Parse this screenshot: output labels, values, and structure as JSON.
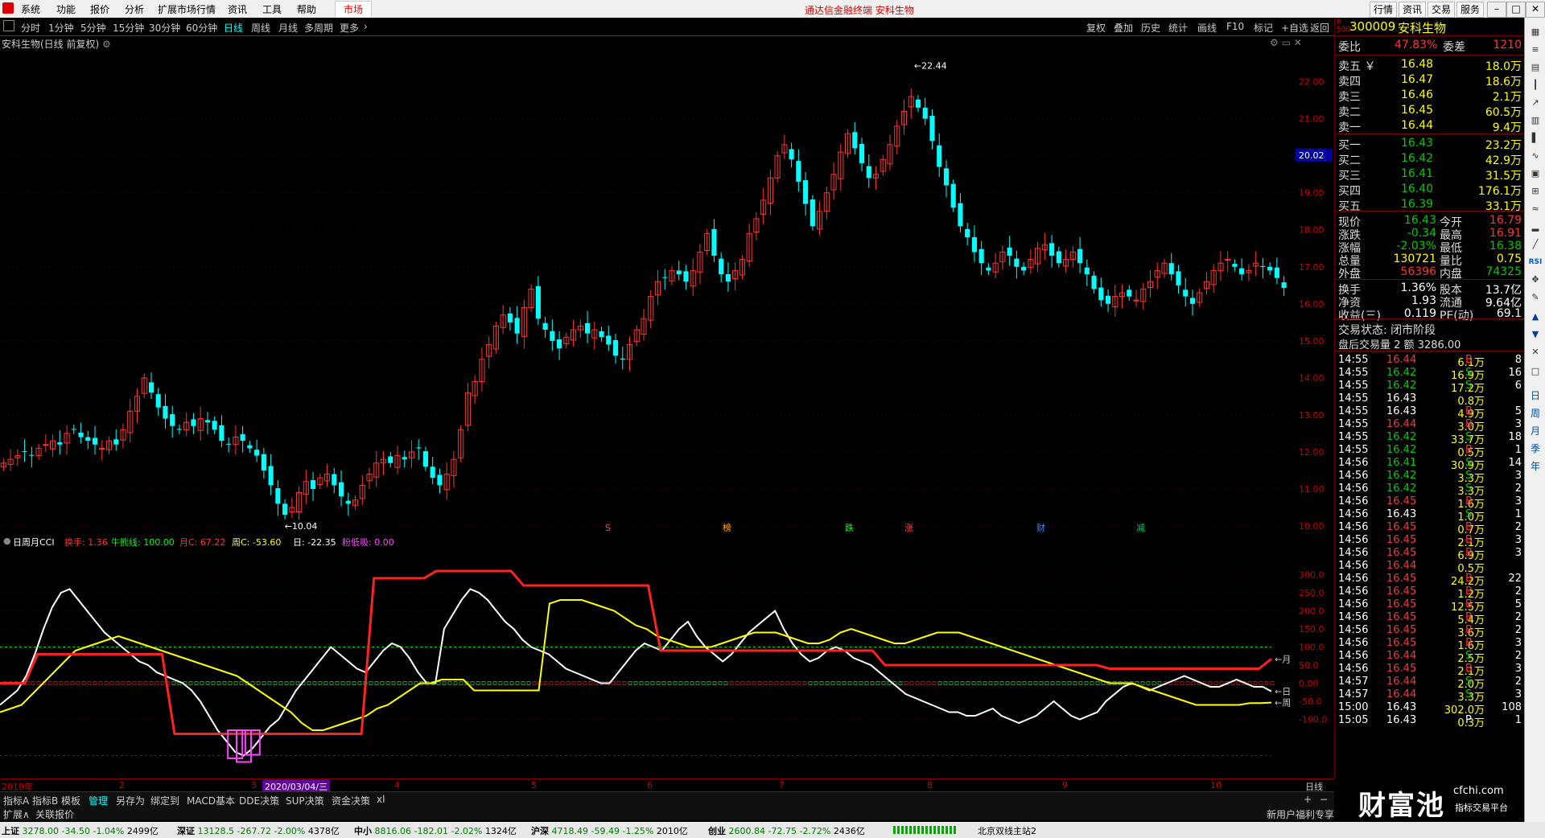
{
  "app": {
    "menu": [
      "系统",
      "功能",
      "报价",
      "分析",
      "扩展市场行情",
      "资讯",
      "工具",
      "帮助"
    ],
    "market_tab": "市场",
    "center_title": "通达信金融终端  安科生物",
    "right_buttons": [
      "行情",
      "资讯",
      "交易",
      "服务"
    ]
  },
  "periods": {
    "items": [
      "分时",
      "1分钟",
      "5分钟",
      "15分钟",
      "30分钟",
      "60分钟",
      "日线",
      "周线",
      "月线",
      "多周期",
      "更多"
    ],
    "active": "日线"
  },
  "chart_tools": [
    "复权",
    "叠加",
    "历史",
    "统计",
    "画线",
    "F10",
    "标记",
    "+自选",
    "返回"
  ],
  "stock_title": "安科生物(日线 前复权)",
  "indicator": {
    "name": "日周月CCI",
    "values": [
      {
        "label": "换手: 1.36",
        "color": "#ff3333"
      },
      {
        "label": "牛熊线: 100.00",
        "color": "#00ff00"
      },
      {
        "label": "月C: 67.22",
        "color": "#ff3333"
      },
      {
        "label": "周C: -53.60",
        "color": "#ffff00"
      },
      {
        "label": "日: -22.35",
        "color": "#ffffff"
      },
      {
        "label": "粉低吸: 0.00",
        "color": "#ff44ff"
      }
    ]
  },
  "chart_data": [
    {
      "type": "candlestick",
      "title": "安科生物(日线 前复权)",
      "ylim": [
        10.0,
        22.6
      ],
      "y_ticks": [
        "22.00",
        "21.00",
        "20.00",
        "19.00",
        "18.00",
        "17.00",
        "16.00",
        "15.00",
        "14.00",
        "13.00",
        "12.00",
        "11.00",
        "10.00"
      ],
      "current_price_label": "20.02",
      "annotations": [
        {
          "text": "22.44",
          "x": "2020/06",
          "y": 22.44
        },
        {
          "text": "10.04",
          "x": "2020/02",
          "y": 10.04
        }
      ],
      "event_markers": [
        "S",
        "榜",
        "跌",
        "涨",
        "财",
        "减"
      ],
      "close": [
        11.7,
        11.8,
        11.9,
        12.0,
        11.9,
        12.1,
        12.2,
        12.3,
        12.2,
        12.5,
        12.6,
        12.4,
        12.3,
        12.2,
        12.1,
        12.3,
        12.2,
        12.6,
        13.1,
        13.5,
        14.0,
        13.6,
        13.2,
        12.9,
        12.7,
        12.6,
        12.8,
        12.7,
        12.9,
        12.8,
        12.6,
        12.3,
        12.2,
        12.4,
        12.3,
        12.1,
        11.9,
        11.5,
        11.1,
        10.6,
        10.3,
        10.5,
        10.9,
        11.2,
        11.0,
        11.3,
        11.4,
        11.1,
        10.8,
        10.6,
        10.7,
        11.1,
        11.4,
        11.7,
        11.8,
        11.7,
        11.9,
        11.8,
        12.0,
        12.1,
        11.6,
        11.3,
        11.1,
        11.4,
        11.8,
        12.6,
        13.6,
        13.9,
        14.5,
        14.9,
        15.4,
        15.7,
        15.5,
        15.2,
        15.9,
        16.4,
        15.6,
        15.3,
        15.0,
        14.8,
        15.1,
        15.3,
        15.4,
        15.2,
        15.3,
        15.1,
        14.9,
        14.6,
        14.5,
        14.9,
        15.3,
        15.6,
        16.2,
        16.6,
        16.7,
        16.9,
        16.8,
        16.6,
        16.9,
        17.4,
        17.9,
        17.3,
        16.8,
        16.6,
        16.9,
        17.2,
        17.9,
        18.3,
        18.8,
        19.4,
        20.0,
        20.3,
        19.9,
        19.3,
        18.7,
        18.1,
        18.5,
        19.0,
        19.5,
        20.1,
        20.6,
        20.2,
        19.8,
        19.4,
        19.5,
        19.9,
        20.3,
        20.8,
        21.2,
        21.6,
        21.3,
        21.0,
        20.4,
        19.7,
        19.2,
        18.6,
        18.1,
        17.8,
        17.4,
        17.1,
        16.9,
        17.1,
        17.4,
        17.3,
        17.0,
        16.9,
        17.2,
        17.5,
        17.6,
        17.3,
        17.1,
        17.2,
        17.4,
        17.1,
        16.8,
        16.4,
        16.1,
        16.0,
        16.2,
        16.3,
        16.2,
        16.1,
        16.4,
        16.6,
        16.9,
        17.1,
        16.8,
        16.5,
        16.2,
        16.0,
        16.3,
        16.6,
        16.9,
        17.1,
        17.2,
        17.0,
        16.8,
        16.9,
        17.1,
        17.0,
        16.9,
        16.7,
        16.43
      ]
    },
    {
      "type": "line",
      "title": "日周月CCI",
      "ylim": [
        -250,
        350
      ],
      "y_ticks": [
        "300.0",
        "250.0",
        "200.0",
        "150.0",
        "100.0",
        "50.0",
        "0.00",
        "-50.0",
        "-100.0"
      ],
      "series": [
        {
          "name": "日",
          "color": "#ffffff",
          "values": [
            -60,
            -40,
            -20,
            20,
            80,
            150,
            210,
            250,
            260,
            230,
            200,
            170,
            140,
            120,
            100,
            80,
            60,
            50,
            30,
            20,
            10,
            0,
            -20,
            -50,
            -90,
            -130,
            -160,
            -190,
            -200,
            -180,
            -150,
            -120,
            -100,
            -60,
            -20,
            10,
            40,
            70,
            100,
            80,
            60,
            40,
            30,
            60,
            90,
            110,
            100,
            70,
            30,
            0,
            0,
            150,
            190,
            230,
            260,
            250,
            230,
            200,
            170,
            150,
            120,
            100,
            90,
            80,
            60,
            40,
            30,
            20,
            10,
            0,
            0,
            30,
            60,
            90,
            110,
            100,
            90,
            120,
            150,
            170,
            130,
            100,
            80,
            60,
            80,
            110,
            140,
            160,
            180,
            200,
            150,
            110,
            80,
            60,
            70,
            90,
            100,
            90,
            70,
            60,
            50,
            30,
            10,
            -10,
            -30,
            -40,
            -50,
            -60,
            -70,
            -80,
            -80,
            -90,
            -90,
            -80,
            -70,
            -90,
            -100,
            -110,
            -100,
            -90,
            -70,
            -50,
            -70,
            -90,
            -100,
            -90,
            -80,
            -50,
            -30,
            -10,
            0,
            -10,
            -20,
            -10,
            0,
            10,
            20,
            10,
            0,
            -10,
            -10,
            0,
            10,
            0,
            -10,
            -10,
            -22.35
          ]
        },
        {
          "name": "周",
          "color": "#ffff00",
          "values": [
            -80,
            -70,
            -60,
            -30,
            0,
            30,
            60,
            90,
            100,
            110,
            120,
            130,
            120,
            110,
            100,
            90,
            80,
            70,
            60,
            50,
            40,
            30,
            20,
            0,
            -20,
            -40,
            -60,
            -80,
            -110,
            -130,
            -130,
            -120,
            -110,
            -100,
            -90,
            -70,
            -60,
            -40,
            -20,
            0,
            0,
            10,
            10,
            10,
            -20,
            -20,
            -20,
            -20,
            -20,
            -20,
            -20,
            220,
            230,
            230,
            230,
            220,
            210,
            200,
            180,
            160,
            150,
            130,
            120,
            110,
            100,
            100,
            100,
            110,
            120,
            130,
            140,
            140,
            140,
            130,
            120,
            110,
            110,
            120,
            140,
            150,
            140,
            130,
            120,
            110,
            110,
            120,
            130,
            140,
            140,
            140,
            130,
            120,
            110,
            100,
            90,
            80,
            70,
            60,
            50,
            40,
            30,
            20,
            10,
            0,
            0,
            0,
            -10,
            -20,
            -30,
            -40,
            -50,
            -60,
            -60,
            -60,
            -60,
            -60,
            -55,
            -55,
            -53.6
          ]
        },
        {
          "name": "月",
          "color": "#ff2222",
          "values": [
            0,
            0,
            0,
            80,
            80,
            80,
            80,
            80,
            80,
            80,
            80,
            80,
            80,
            80,
            -140,
            -140,
            -140,
            -140,
            -140,
            -140,
            -140,
            -140,
            -140,
            -140,
            -140,
            -140,
            -140,
            -140,
            -140,
            -140,
            290,
            290,
            290,
            290,
            290,
            310,
            310,
            310,
            310,
            310,
            310,
            310,
            270,
            270,
            270,
            270,
            270,
            270,
            270,
            270,
            270,
            270,
            270,
            90,
            90,
            90,
            90,
            90,
            90,
            90,
            90,
            90,
            90,
            90,
            90,
            90,
            90,
            90,
            90,
            90,
            90,
            50,
            50,
            50,
            50,
            50,
            50,
            50,
            50,
            50,
            50,
            50,
            50,
            50,
            50,
            50,
            50,
            50,
            50,
            40,
            40,
            40,
            40,
            40,
            40,
            40,
            40,
            40,
            40,
            40,
            40,
            40,
            67.22
          ]
        }
      ]
    }
  ],
  "xaxis": {
    "labels": [
      "2019年",
      "2",
      "3",
      "2020/03/04/三",
      "4",
      "5",
      "6",
      "7",
      "8",
      "9",
      "10"
    ],
    "period": "日线"
  },
  "bottom_tabs": [
    "指标A",
    "指标B",
    "模板",
    "管理",
    "另存为",
    "绑定到",
    "MACD基本",
    "DDE决策",
    "SUP决策",
    "资金决策",
    "xl"
  ],
  "bottom_tabs2": [
    "扩展∧",
    "关联报价"
  ],
  "quote": {
    "code": "300009",
    "name": "安科生物",
    "weibi_label": "委比",
    "weibi": "47.83%",
    "weicha_label": "委差",
    "weicha": "1210",
    "asks": [
      {
        "label": "卖五",
        "mark": "￥",
        "price": "16.48",
        "vol": "18.0万"
      },
      {
        "label": "卖四",
        "mark": "",
        "price": "16.47",
        "vol": "18.6万"
      },
      {
        "label": "卖三",
        "mark": "",
        "price": "16.46",
        "vol": "2.1万"
      },
      {
        "label": "卖二",
        "mark": "",
        "price": "16.45",
        "vol": "60.5万"
      },
      {
        "label": "卖一",
        "mark": "",
        "price": "16.44",
        "vol": "9.4万"
      }
    ],
    "bids": [
      {
        "label": "买一",
        "price": "16.43",
        "vol": "23.2万"
      },
      {
        "label": "买二",
        "price": "16.42",
        "vol": "42.9万"
      },
      {
        "label": "买三",
        "price": "16.41",
        "vol": "31.5万"
      },
      {
        "label": "买四",
        "price": "16.40",
        "vol": "176.1万"
      },
      {
        "label": "买五",
        "price": "16.39",
        "vol": "33.1万"
      }
    ],
    "stats": [
      {
        "l1": "现价",
        "v1": "16.43",
        "c1": "dn",
        "l2": "今开",
        "v2": "16.79",
        "c2": "up"
      },
      {
        "l1": "涨跌",
        "v1": "-0.34",
        "c1": "dn",
        "l2": "最高",
        "v2": "16.91",
        "c2": "up"
      },
      {
        "l1": "涨幅",
        "v1": "-2.03%",
        "c1": "dn",
        "l2": "最低",
        "v2": "16.38",
        "c2": "dn"
      },
      {
        "l1": "总量",
        "v1": "130721",
        "c1": "yl",
        "l2": "量比",
        "v2": "0.75",
        "c2": "yl"
      },
      {
        "l1": "外盘",
        "v1": "56396",
        "c1": "up",
        "l2": "内盘",
        "v2": "74325",
        "c2": "dn"
      }
    ],
    "stats2": [
      {
        "l1": "换手",
        "v1": "1.36%",
        "l2": "股本",
        "v2": "13.7亿"
      },
      {
        "l1": "净资",
        "v1": "1.93",
        "l2": "流通",
        "v2": "9.64亿"
      },
      {
        "l1": "收益(三)",
        "v1": "0.119",
        "l2": "PE(动)",
        "v2": "69.1"
      }
    ],
    "trade_state": "交易状态: 闭市阶段",
    "after_hours": "盘后交易量 2 额 3286.00"
  },
  "ticks": [
    [
      "14:55",
      "16.44",
      "6.1万",
      "B",
      "8"
    ],
    [
      "14:55",
      "16.42",
      "16.9万",
      "S",
      "16"
    ],
    [
      "14:55",
      "16.42",
      "17.2万",
      "S",
      "6"
    ],
    [
      "14:55",
      "16.43",
      "0.8万",
      "",
      ""
    ],
    [
      "14:55",
      "16.43",
      "4.9万",
      "B",
      "5"
    ],
    [
      "14:55",
      "16.44",
      "3.0万",
      "B",
      "3"
    ],
    [
      "14:55",
      "16.42",
      "33.7万",
      "S",
      "18"
    ],
    [
      "14:55",
      "16.42",
      "0.5万",
      "B",
      "1"
    ],
    [
      "14:56",
      "16.41",
      "30.9万",
      "S",
      "14"
    ],
    [
      "14:56",
      "16.42",
      "3.3万",
      "S",
      "3"
    ],
    [
      "14:56",
      "16.42",
      "3.3万",
      "S",
      "2"
    ],
    [
      "14:56",
      "16.45",
      "1.6万",
      "B",
      "3"
    ],
    [
      "14:56",
      "16.43",
      "1.0万",
      "S",
      "1"
    ],
    [
      "14:56",
      "16.45",
      "0.7万",
      "B",
      "2"
    ],
    [
      "14:56",
      "16.45",
      "2.1万",
      "B",
      "3"
    ],
    [
      "14:56",
      "16.45",
      "6.9万",
      "B",
      "3"
    ],
    [
      "14:56",
      "16.44",
      "0.5万",
      "",
      ""
    ],
    [
      "14:56",
      "16.45",
      "24.2万",
      "B",
      "22"
    ],
    [
      "14:56",
      "16.45",
      "1.2万",
      "B",
      "2"
    ],
    [
      "14:56",
      "16.45",
      "12.5万",
      "B",
      "5"
    ],
    [
      "14:56",
      "16.45",
      "5.4万",
      "B",
      "2"
    ],
    [
      "14:56",
      "16.45",
      "3.6万",
      "B",
      "2"
    ],
    [
      "14:56",
      "16.45",
      "1.6万",
      "B",
      "3"
    ],
    [
      "14:56",
      "16.44",
      "2.5万",
      "S",
      "2"
    ],
    [
      "14:56",
      "16.45",
      "2.1万",
      "B",
      "3"
    ],
    [
      "14:57",
      "16.44",
      "2.0万",
      "S",
      "2"
    ],
    [
      "14:57",
      "16.44",
      "3.3万",
      "S",
      "3"
    ],
    [
      "15:00",
      "16.43",
      "302.0万",
      "",
      "108"
    ],
    [
      "15:05",
      "16.43",
      "0.3万",
      "P",
      "1"
    ]
  ],
  "statusbar": {
    "indices": [
      {
        "name": "上证",
        "val": "3278.00",
        "chg": "-34.50",
        "pct": "-1.04%",
        "amt": "2499亿"
      },
      {
        "name": "深证",
        "val": "13128.5",
        "chg": "-267.72",
        "pct": "-2.00%",
        "amt": "4378亿"
      },
      {
        "name": "中小",
        "val": "8816.06",
        "chg": "-182.01",
        "pct": "-2.02%",
        "amt": "1324亿"
      },
      {
        "name": "沪深",
        "val": "4718.49",
        "chg": "-59.49",
        "pct": "-1.25%",
        "amt": "2010亿"
      },
      {
        "name": "创业",
        "val": "2600.84",
        "chg": "-72.75",
        "pct": "-2.72%",
        "amt": "2436亿"
      }
    ],
    "server": "北京双线主站2",
    "promo": "新用户福利专享"
  },
  "logo": {
    "main": "财富池",
    "site": "cfchi.com",
    "sub": "指标交易平台"
  },
  "colors": {
    "up": "#ff3333",
    "down": "#00ffff",
    "accent": "#d00000"
  }
}
